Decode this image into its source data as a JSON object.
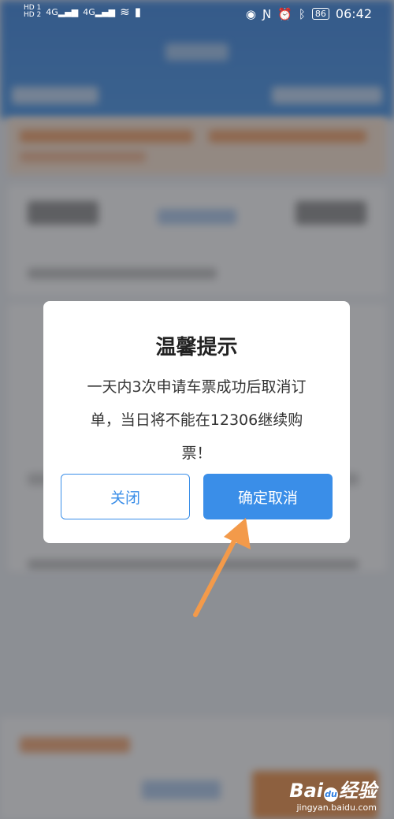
{
  "status_bar": {
    "left_badges": [
      "HD 1",
      "HD 2"
    ],
    "network": [
      "4G",
      "4G"
    ],
    "battery": "86",
    "time": "06:42"
  },
  "dialog": {
    "title": "温馨提示",
    "message_lines": [
      "一天内3次申请车票成功后取消订",
      "单，当日将不能在12306继续购",
      "票！"
    ],
    "close_button": "关闭",
    "confirm_button": "确定取消"
  },
  "colors": {
    "accent": "#3a8ee8",
    "annotation_arrow": "#f39a4a"
  },
  "watermark": {
    "brand_a": "Bai",
    "brand_b": "经验",
    "url": "jingyan.baidu.com"
  }
}
